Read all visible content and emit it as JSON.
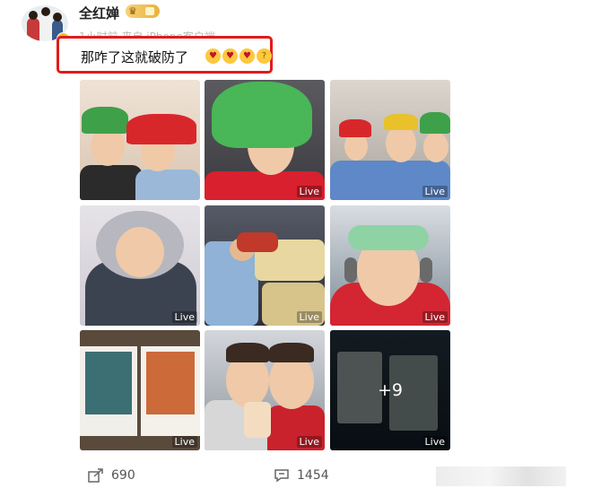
{
  "post": {
    "username": "全红婵",
    "badge_icon": "crown-icon",
    "source": "1小时前 来自 iPhone客户端",
    "text": "那咋了这就破防了",
    "emojis": [
      "heart-eyes-emoji",
      "heart-eyes-emoji",
      "heart-eyes-emoji",
      "thinking-emoji"
    ]
  },
  "grid": {
    "live_label": "Live",
    "more_count": "+9"
  },
  "actions": {
    "share_count": "690",
    "comment_count": "1454"
  },
  "colors": {
    "highlight_border": "#e11b1b",
    "verify_badge": "#f5b82e"
  }
}
